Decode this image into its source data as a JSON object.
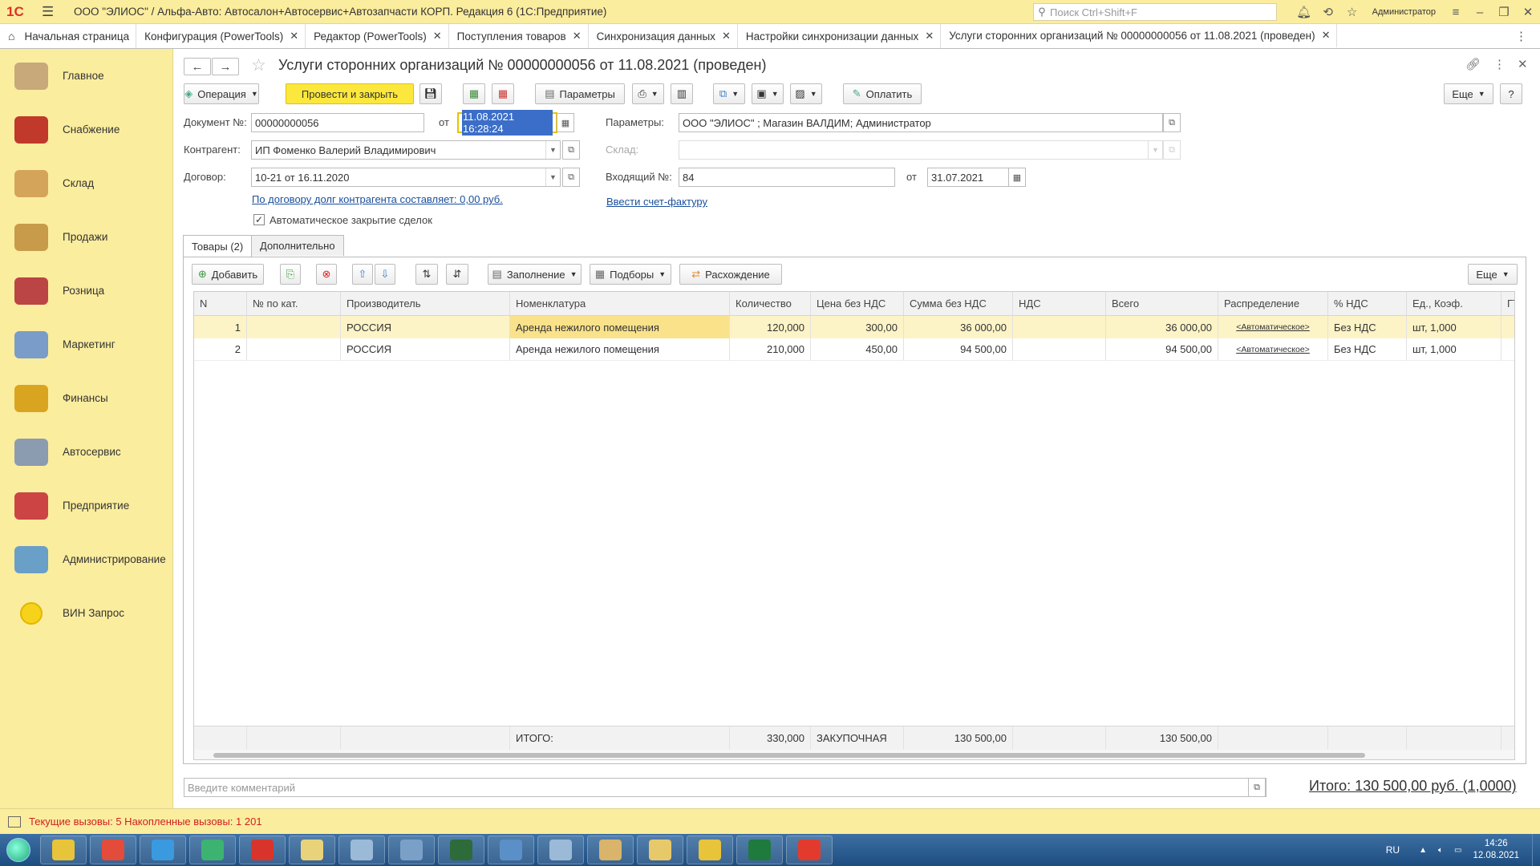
{
  "app": {
    "logo": "1С",
    "title": "ООО \"ЭЛИОС\" / Альфа-Авто: Автосалон+Автосервис+Автозапчасти КОРП. Редакция 6  (1С:Предприятие)",
    "search_placeholder": "Поиск Ctrl+Shift+F",
    "user": "Администратор"
  },
  "tabs": [
    {
      "label": "Начальная страница"
    },
    {
      "label": "Конфигурация (PowerTools)"
    },
    {
      "label": "Редактор (PowerTools)"
    },
    {
      "label": "Поступления товаров"
    },
    {
      "label": "Синхронизация данных"
    },
    {
      "label": "Настройки синхронизации данных"
    },
    {
      "label": "Услуги сторонних организаций № 00000000056 от 11.08.2021 (проведен)"
    }
  ],
  "sidebar": [
    {
      "label": "Главное",
      "icon": "desk-icon",
      "color": "#c8a97a"
    },
    {
      "label": "Снабжение",
      "icon": "truck-icon",
      "color": "#c0392b"
    },
    {
      "label": "Склад",
      "icon": "boxes-icon",
      "color": "#d4a45a"
    },
    {
      "label": "Продажи",
      "icon": "sales-icon",
      "color": "#c79b4a"
    },
    {
      "label": "Розница",
      "icon": "cash-register-icon",
      "color": "#b44"
    },
    {
      "label": "Маркетинг",
      "icon": "chart-board-icon",
      "color": "#7a9cc8"
    },
    {
      "label": "Финансы",
      "icon": "coins-icon",
      "color": "#d9a520"
    },
    {
      "label": "Автосервис",
      "icon": "gear-service-icon",
      "color": "#8b9bb0"
    },
    {
      "label": "Предприятие",
      "icon": "building-icon",
      "color": "#c44"
    },
    {
      "label": "Администрирование",
      "icon": "computer-icon",
      "color": "#6a9fc8"
    },
    {
      "label": "ВИН Запрос",
      "icon": "vin-circle-icon",
      "color": "#f7d21a"
    }
  ],
  "form": {
    "title": "Услуги сторонних организаций № 00000000056 от 11.08.2021 (проведен)",
    "toolbar": {
      "operation": "Операция",
      "post_close": "Провести и закрыть",
      "params": "Параметры",
      "pay": "Оплатить",
      "more": "Еще",
      "help": "?"
    },
    "doc_no_label": "Документ №:",
    "doc_no": "00000000056",
    "from_label": "от",
    "doc_date": "11.08.2021 16:28:24",
    "params_label": "Параметры:",
    "params_value": "ООО \"ЭЛИОС\" ; Магазин ВАЛДИМ; Администратор",
    "contractor_label": "Контрагент:",
    "contractor": "ИП Фоменко Валерий Владимирович",
    "warehouse_label": "Склад:",
    "warehouse": "",
    "contract_label": "Договор:",
    "contract": "10-21 от 16.11.2020",
    "incoming_label": "Входящий №:",
    "incoming_no": "84",
    "incoming_from_label": "от",
    "incoming_date": "31.07.2021",
    "debt_link": "По договору долг контрагента составляет: 0,00 руб.",
    "invoice_link": "Ввести счет-фактуру",
    "auto_close_label": "Автоматическое закрытие сделок",
    "auto_close_checked": true
  },
  "subtabs": [
    {
      "label": "Товары (2)"
    },
    {
      "label": "Дополнительно"
    }
  ],
  "table_toolbar": {
    "add": "Добавить",
    "fill": "Заполнение",
    "select": "Подборы",
    "discrepancy": "Расхождение",
    "more": "Еще"
  },
  "table": {
    "columns": [
      "N",
      "№ по кат.",
      "Производитель",
      "Номенклатура",
      "Количество",
      "Цена без НДС",
      "Сумма без НДС",
      "НДС",
      "Всего",
      "Распределение",
      "% НДС",
      "Ед., Коэф.",
      "ГТ"
    ],
    "rows": [
      [
        "1",
        "",
        "РОССИЯ",
        "Аренда нежилого помещения",
        "120,000",
        "300,00",
        "36 000,00",
        "",
        "36 000,00",
        "<Автоматическое>",
        "Без НДС",
        "шт, 1,000",
        ""
      ],
      [
        "2",
        "",
        "РОССИЯ",
        "Аренда нежилого помещения",
        "210,000",
        "450,00",
        "94 500,00",
        "",
        "94 500,00",
        "<Автоматическое>",
        "Без НДС",
        "шт, 1,000",
        ""
      ]
    ],
    "footer": [
      "",
      "",
      "",
      "ИТОГО:",
      "330,000",
      "ЗАКУПОЧНАЯ",
      "130 500,00",
      "",
      "130 500,00",
      "",
      "",
      "",
      ""
    ]
  },
  "comment_placeholder": "Введите комментарий",
  "total": "Итого: 130 500,00 руб. (1,0000)",
  "status": "Текущие вызовы: 5   Накопленные вызовы: 1 201",
  "taskbar": {
    "apps": [
      {
        "icon": "1c-icon",
        "color": "#e8c43a"
      },
      {
        "icon": "chrome-icon",
        "color": "#e34b3b"
      },
      {
        "icon": "ie-icon",
        "color": "#3a9ae0"
      },
      {
        "icon": "mail-icon",
        "color": "#3cb371"
      },
      {
        "icon": "pdf-icon",
        "color": "#d9342b"
      },
      {
        "icon": "folder-icon",
        "color": "#e8d37a"
      },
      {
        "icon": "notepad-icon",
        "color": "#9bbad8"
      },
      {
        "icon": "network-icon",
        "color": "#7aa0c8"
      },
      {
        "icon": "terminal-icon",
        "color": "#2e6b3a"
      },
      {
        "icon": "screen-icon",
        "color": "#5b8fc7"
      },
      {
        "icon": "edit-icon",
        "color": "#9bbad8"
      },
      {
        "icon": "paint-icon",
        "color": "#d9b46a"
      },
      {
        "icon": "explorer-icon",
        "color": "#e8c96a"
      },
      {
        "icon": "1c-icon",
        "color": "#e8c43a"
      },
      {
        "icon": "excel-icon",
        "color": "#1f7a3d"
      },
      {
        "icon": "anydesk-icon",
        "color": "#e23b2e"
      }
    ],
    "lang": "RU",
    "time": "14:26",
    "date": "12.08.2021"
  }
}
